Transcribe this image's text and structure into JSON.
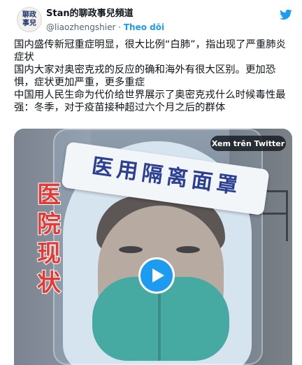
{
  "author": {
    "avatar_text_line1": "聊政",
    "avatar_text_line2": "事兒",
    "name": "Stan的聊政事兒頻道",
    "handle": "@liaozhengshier",
    "separator": "·",
    "follow_label": "Theo dõi"
  },
  "tweet": {
    "paragraphs": [
      "国内盛传新冠重症明显，很大比例“白肺”，指出现了严重肺炎症状",
      "国内大家对奥密克戎的反应的确和海外有很大区别。更加恐惧，症状更加严重，更多重症",
      "中国用人民生命为代价给世界展示了奥密克戎什么时候毒性最强：冬季，对于疫苗接种超过六个月之后的群体"
    ]
  },
  "media": {
    "headband_text": "医用隔离面罩",
    "side_label": [
      "医",
      "院",
      "现",
      "状"
    ],
    "watch_label": "Xem trên Twitter"
  },
  "icons": {
    "brand": "twitter-bird-icon",
    "play": "play-icon"
  },
  "colors": {
    "brand_blue": "#1d9bf0",
    "text": "#0f1419",
    "muted": "#536471",
    "label_red": "#e53a34",
    "headband_blue": "#2b3f93"
  }
}
